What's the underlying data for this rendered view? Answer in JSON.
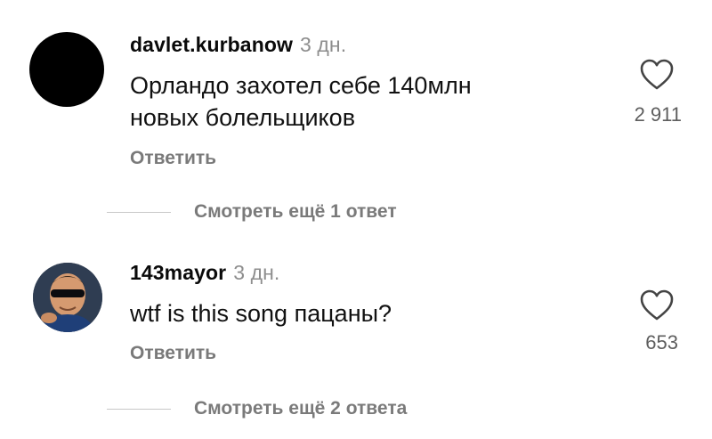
{
  "comments": [
    {
      "username": "davlet.kurbanow",
      "time": "3 дн.",
      "text_lines": [
        "Орландо захотел себе 140млн",
        "новых болельщиков"
      ],
      "reply_label": "Ответить",
      "likes": "2 911",
      "more_replies": "Смотреть ещё 1 ответ",
      "avatar": "black-circle-avatar"
    },
    {
      "username": "143mayor",
      "time": "3 дн.",
      "text_lines": [
        "wtf is this song пацаны?"
      ],
      "reply_label": "Ответить",
      "likes": "653",
      "more_replies": "Смотреть ещё 2 ответа",
      "avatar": "photo-avatar-man-with-sunglasses"
    }
  ],
  "icons": {
    "like": "heart-outline-icon"
  },
  "colors": {
    "text": "#111111",
    "secondary": "#8e8e8e",
    "action": "#7a7a7a",
    "background": "#ffffff"
  }
}
